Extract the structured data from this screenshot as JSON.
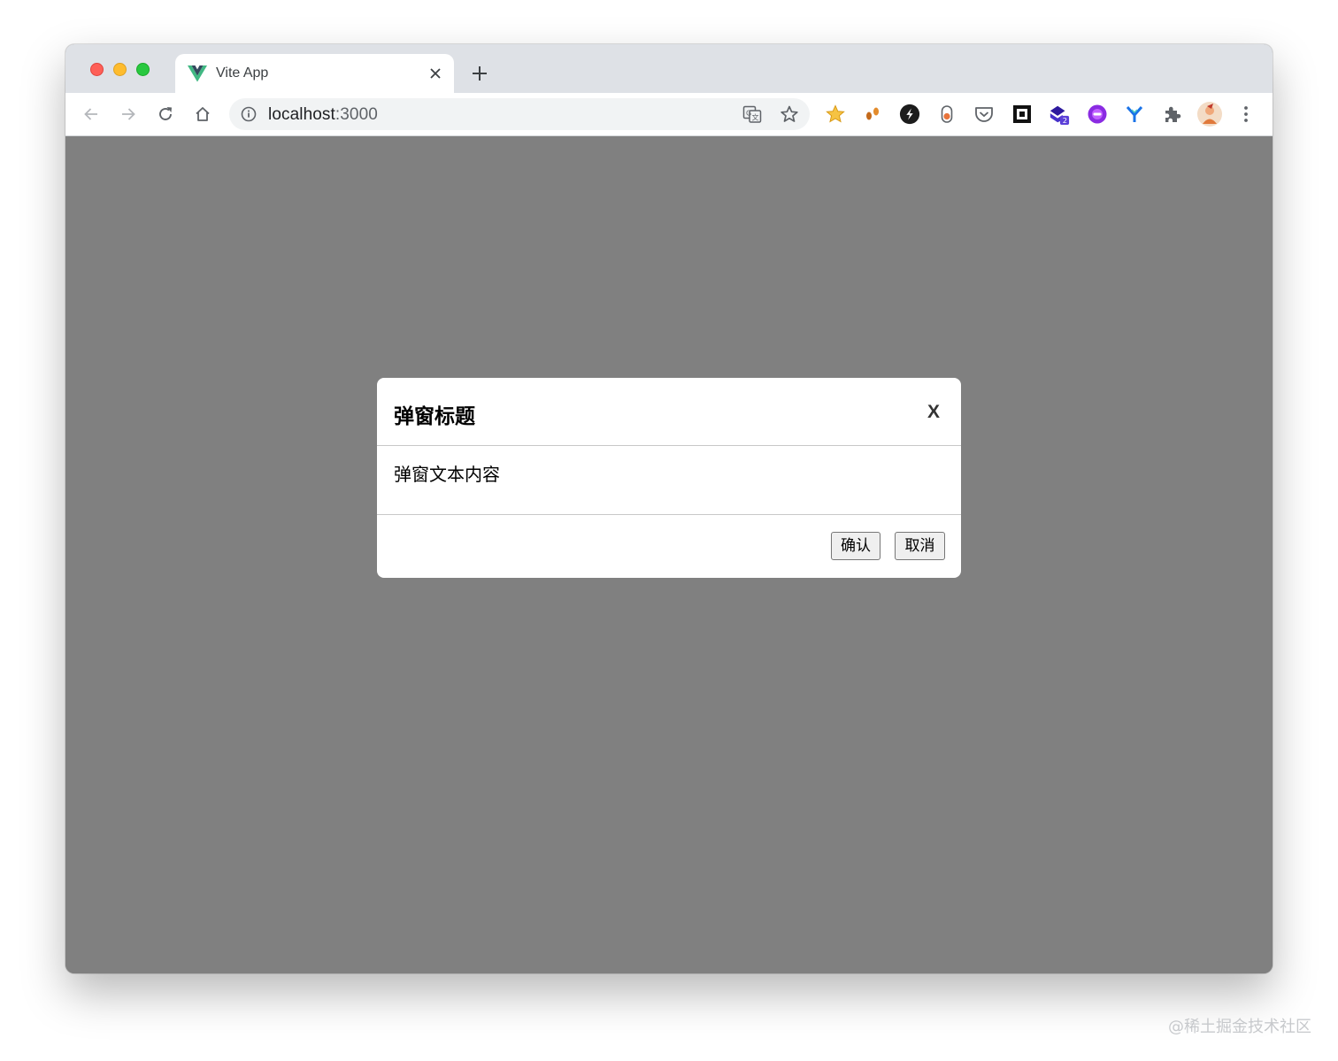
{
  "browser": {
    "tab": {
      "title": "Vite App",
      "favicon": "vue-logo-icon"
    },
    "address_bar": {
      "host": "localhost",
      "port": ":3000"
    },
    "extensions": [
      "star-extension-icon",
      "footprints-extension-icon",
      "dark-circle-extension-icon",
      "pill-extension-icon",
      "pocket-icon",
      "square-extension-icon",
      "stack-extension-icon",
      "purple-circle-extension-icon",
      "y-extension-icon",
      "puzzle-icon",
      "profile-avatar"
    ],
    "extension_badge": "2"
  },
  "modal": {
    "title": "弹窗标题",
    "close_label": "X",
    "body_text": "弹窗文本内容",
    "confirm_label": "确认",
    "cancel_label": "取消"
  },
  "watermark": "@稀土掘金技术社区",
  "colors": {
    "overlay": "#808080",
    "tabstrip": "#dee1e6",
    "vue_green": "#41b883",
    "vue_dark": "#34495e"
  }
}
